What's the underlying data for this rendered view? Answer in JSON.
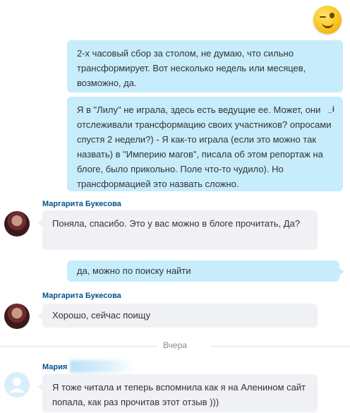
{
  "messages": {
    "m1": "2-х часовый сбор за столом, не думаю, что сильно трансформирует. Вот несколько недель или месяцев, возможно, да.",
    "m2": "Я в \"Лилу\" не играла, здесь есть ведущие ее. Может, они отслеживали трансформацию своих участников? опросами спустя 2 недели?)  - Я как-то играла (если это можно так назвать) в \"Империю магов\", писала об этом репортаж на блоге, было прикольно. Поле что-то чудило). Но трансформацией это назвать сложно.",
    "m2_edit_marker": "_i",
    "m3_sender": "Маргарита Букесова",
    "m3": "Поняла, спасибо. Это у вас можно в блоге прочитать, Да?",
    "m4": "да, можно по поиску найти",
    "m5_sender": "Маргарита Букесова",
    "m5": "Хорошо, сейчас поищу",
    "divider": "Вчера",
    "m6_sender": "Мария",
    "m6": "Я тоже читала и теперь вспомнила как я на Аленином сайт попала, как раз прочитав этот отзыв )))"
  },
  "icons": [
    "winking-emoji-icon",
    "avatar-photo",
    "default-avatar-icon",
    "edit-icon"
  ],
  "colors": {
    "outgoing_bubble": "#c7edfc",
    "incoming_bubble": "#f0f1f4",
    "sender_name": "#00548c"
  }
}
